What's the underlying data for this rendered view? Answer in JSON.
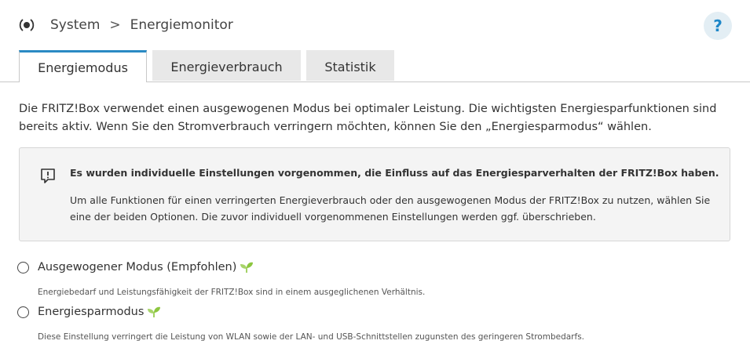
{
  "breadcrumb": {
    "root": "System",
    "separator": ">",
    "current": "Energiemonitor"
  },
  "help": {
    "label": "?"
  },
  "tabs": [
    {
      "label": "Energiemodus",
      "active": true
    },
    {
      "label": "Energieverbrauch",
      "active": false
    },
    {
      "label": "Statistik",
      "active": false
    }
  ],
  "intro": "Die FRITZ!Box verwendet einen ausgewogenen Modus bei optimaler Leistung. Die wichtigsten Energiesparfunktionen sind bereits aktiv. Wenn Sie den Stromverbrauch verringern möchten, können Sie den „Energiesparmodus“ wählen.",
  "info": {
    "icon": "exclamation-speech-icon",
    "title": "Es wurden individuelle Einstellungen vorgenommen, die Einfluss auf das Energiesparverhalten der FRITZ!Box haben.",
    "text": "Um alle Funktionen für einen verringerten Energieverbrauch oder den ausgewogenen Modus der FRITZ!Box zu nutzen, wählen Sie eine der beiden Optionen. Die zuvor individuell  vorgenommenen Einstellungen werden ggf. überschrieben."
  },
  "options": [
    {
      "label": "Ausgewogener Modus (Empfohlen)",
      "description": "Energiebedarf und Leistungsfähigkeit der FRITZ!Box sind in einem ausgeglichenen Verhältnis.",
      "selected": false
    },
    {
      "label": "Energiesparmodus",
      "description": "Diese Einstellung verringert die Leistung von WLAN sowie der LAN- und USB-Schnittstellen zugunsten des geringeren Strombedarfs.",
      "selected": false
    }
  ],
  "colors": {
    "accent": "#2a8ac4",
    "leaf": "#8cc63f",
    "help_bg": "#e3eef4"
  }
}
